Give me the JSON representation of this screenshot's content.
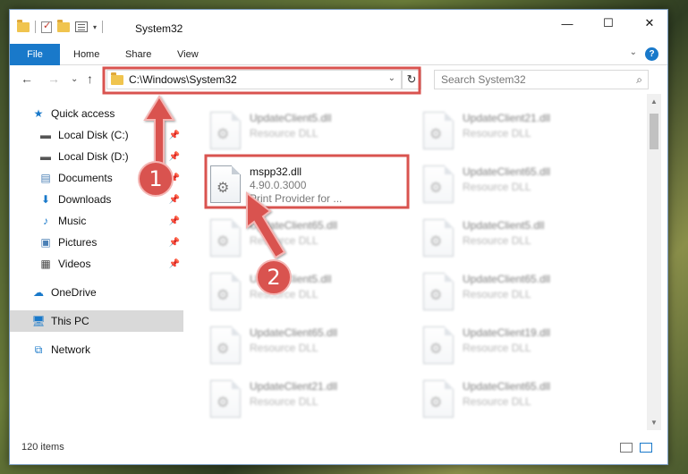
{
  "window": {
    "title": "System32",
    "minimize": "—",
    "maximize": "☐",
    "close": "✕"
  },
  "ribbon": {
    "file": "File",
    "tabs": [
      "Home",
      "Share",
      "View"
    ],
    "expand": "⌄",
    "help": "?"
  },
  "navbar": {
    "back": "←",
    "forward": "→",
    "recent": "⌄",
    "up": "↑",
    "address": "C:\\Windows\\System32",
    "address_dropdown": "⌄",
    "refresh": "↻",
    "search_placeholder": "Search System32",
    "search_icon": "⌕"
  },
  "navpane": {
    "items": [
      {
        "label": "Quick access",
        "icon": "star-icon"
      },
      {
        "label": "Local Disk (C:)",
        "icon": "drive-icon",
        "pinned": true
      },
      {
        "label": "Local Disk (D:)",
        "icon": "drive-icon",
        "pinned": true
      },
      {
        "label": "Documents",
        "icon": "documents-icon",
        "pinned": true
      },
      {
        "label": "Downloads",
        "icon": "download-icon",
        "pinned": true
      },
      {
        "label": "Music",
        "icon": "music-icon",
        "pinned": true
      },
      {
        "label": "Pictures",
        "icon": "pictures-icon",
        "pinned": true
      },
      {
        "label": "Videos",
        "icon": "videos-icon",
        "pinned": true
      },
      {
        "label": "OneDrive",
        "icon": "cloud-icon"
      },
      {
        "label": "This PC",
        "icon": "computer-icon",
        "selected": true
      },
      {
        "label": "Network",
        "icon": "network-icon"
      }
    ]
  },
  "files": [
    {
      "name": "UpdateClient5.dll",
      "desc": "Resource DLL"
    },
    {
      "name": "UpdateClient21.dll",
      "desc": "Resource DLL"
    },
    {
      "name": "mspp32.dll",
      "version": "4.90.0.3000",
      "desc": "Print Provider for ..."
    },
    {
      "name": "UpdateClient65.dll",
      "desc": "Resource DLL"
    },
    {
      "name": "UpdateClient65.dll",
      "desc": "Resource DLL"
    },
    {
      "name": "UpdateClient5.dll",
      "desc": "Resource DLL"
    },
    {
      "name": "UpdateClient5.dll",
      "desc": "Resource DLL"
    },
    {
      "name": "UpdateClient65.dll",
      "desc": "Resource DLL"
    },
    {
      "name": "UpdateClient65.dll",
      "desc": "Resource DLL"
    },
    {
      "name": "UpdateClient19.dll",
      "desc": "Resource DLL"
    },
    {
      "name": "UpdateClient21.dll",
      "desc": "Resource DLL"
    },
    {
      "name": "UpdateClient65.dll",
      "desc": "Resource DLL"
    }
  ],
  "status": {
    "count": "120 items"
  },
  "annotations": {
    "step1": "1",
    "step2": "2",
    "color": "#d9534f"
  }
}
